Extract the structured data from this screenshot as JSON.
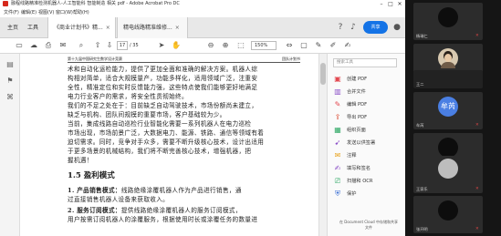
{
  "acrobat": {
    "title": "融程线路精准检测机器人-人工智能科 智能制造 相关 pdf - Adobe Acrobat Pro DC",
    "menu": [
      "文件(F)",
      "编辑(E)",
      "视图(V)",
      "窗口(W)",
      "帮助(H)"
    ],
    "tabs": {
      "home": "主页",
      "tools": "工具",
      "doc1": "《商业计划书》精...",
      "doc2": "精电线路精准维修..."
    },
    "share_label": "共享",
    "page_current": "17",
    "page_total": "/ 35",
    "zoom": "150%",
    "icons": {
      "save": "save-icon",
      "cloud": "cloud-icon",
      "print": "print-icon",
      "email": "mail-icon",
      "search": "search-icon",
      "prev": "arrow-up-icon",
      "next": "arrow-down-icon",
      "select": "cursor-icon",
      "hand": "hand-icon",
      "zoom_out": "minus-icon",
      "zoom_in": "plus-icon",
      "fit": "fit-page-icon",
      "comment": "comment-icon",
      "pen": "pen-icon",
      "sign": "sign-icon",
      "help": "help-icon",
      "bell": "bell-icon"
    }
  },
  "document": {
    "running_left": "第十九届中国研究生数学设计竞赛",
    "running_right": "团队计划书",
    "paragraph_lines": [
      "术和自动化运检能力，提供了更加全面和准确的解决方案。机器人综",
      "构相对简单，适合大规模量产，功能多样化，适用领域广泛，注重安",
      "全性，精准定位和实时反馈能力强，这些特点使我们能够更好地满足",
      "电力行业客户的需求，将安全性贯彻始终。",
      "    我们的不足之处在于：目前缺乏自动驾驶技术，市场份额尚未建立，",
      "缺乏与机构、团队间规模的重要市场，客户基础较为少。",
      "    当前，集成线路自动巡检行业智能化需要一系列机器人在电力巡检",
      "市场出现，市场前景广泛，大数据电力、能源、铁路、通信等领域有着",
      "迫切需求。同时，竞争对手众多，需要不断升级核心技术，设计出适用",
      "于更多场景的机械结构，我们将不断完善核心技术，增强机器，把",
      "握机遇！"
    ],
    "section_heading": "1.5 盈利模式",
    "list_items": [
      {
        "bold": "1. 产品销售模式：",
        "text": "线路绝缘涂覆机器人作为产品进行销售，通"
      },
      {
        "bold": "",
        "text": "过直接销售机器人设备来获取收入。"
      },
      {
        "bold": "2. 服务订阅模式：",
        "text": "提供线路绝缘涂覆机器人的服务订阅模式，"
      },
      {
        "bold": "",
        "text": "用户按需订阅机器人的涂覆服务，根据使用时长或涂覆任务的数量进"
      }
    ]
  },
  "right_panel": {
    "search_placeholder": "搜索工具",
    "tools": [
      {
        "label": "创建 PDF",
        "icon": "create-pdf-icon",
        "color": "#e34850"
      },
      {
        "label": "合并文件",
        "icon": "combine-files-icon",
        "color": "#8b4fc7"
      },
      {
        "label": "编辑 PDF",
        "icon": "edit-pdf-icon",
        "color": "#e34850"
      },
      {
        "label": "导出 PDF",
        "icon": "export-pdf-icon",
        "color": "#d9432a"
      },
      {
        "label": "组织页面",
        "icon": "organize-pages-icon",
        "color": "#2fa865"
      },
      {
        "label": "发送以供签署",
        "icon": "send-for-signature-icon",
        "color": "#8b4fc7"
      },
      {
        "label": "注释",
        "icon": "comment-tool-icon",
        "color": "#e8a21c"
      },
      {
        "label": "填写和签名",
        "icon": "fill-sign-icon",
        "color": "#8b4fc7"
      },
      {
        "label": "扫描和 OCR",
        "icon": "scan-ocr-icon",
        "color": "#2fa865"
      },
      {
        "label": "保护",
        "icon": "protect-icon",
        "color": "#3b6fd4"
      }
    ],
    "footer": "在 Document Cloud 中存储和共享文件"
  },
  "meeting": {
    "participants": [
      {
        "name": "杨瑞仁",
        "avatar": "dark"
      },
      {
        "name": "",
        "avatar": "photo"
      },
      {
        "name": "王二",
        "avatar": "grey"
      },
      {
        "name": "牟芮",
        "avatar": "text",
        "avatar_text": "牟芮"
      },
      {
        "name": "吴磊",
        "avatar": "dark"
      },
      {
        "name": "王家乐",
        "avatar": "grey"
      },
      {
        "name": "张开明",
        "avatar": "dark"
      }
    ]
  }
}
